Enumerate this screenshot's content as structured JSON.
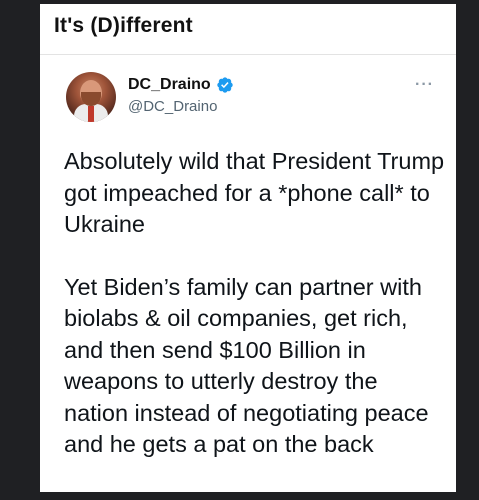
{
  "header": {
    "title": "It's (D)ifferent"
  },
  "tweet": {
    "display_name": "DC_Draino",
    "handle": "@DC_Draino",
    "more_label": "···",
    "verified": true,
    "paragraphs": [
      "Absolutely wild that President Trump got impeached for a *phone call* to Ukraine",
      "Yet Biden’s family can partner with biolabs & oil companies, get rich, and then send $100 Billion in weapons to utterly destroy the nation instead of negotiating peace and he gets a pat on the back"
    ]
  },
  "colors": {
    "background": "#1f2023",
    "card": "#ffffff",
    "text": "#0f1419",
    "handle": "#536471",
    "verified": "#1d9bf0"
  },
  "icons": {
    "avatar": "avatar-image",
    "verified": "verified-badge-icon",
    "more": "more-options-icon"
  }
}
